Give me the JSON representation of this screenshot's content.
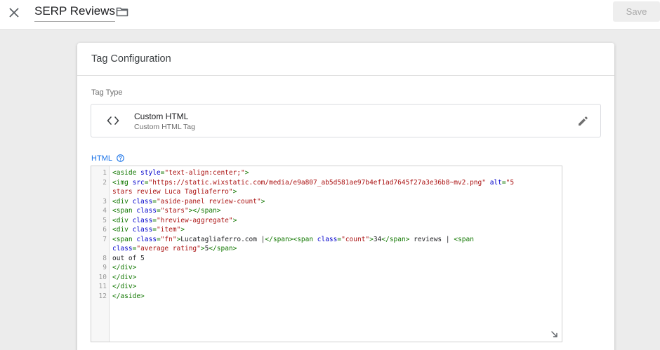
{
  "header": {
    "title": "SERP Reviews",
    "save_label": "Save"
  },
  "card": {
    "title": "Tag Configuration",
    "tag_type_label": "Tag Type",
    "tag_type": {
      "name": "Custom HTML",
      "description": "Custom HTML Tag"
    },
    "html_label": "HTML"
  },
  "icons": {
    "close": "close-icon",
    "folder": "folder-icon",
    "code": "code-icon",
    "edit": "pencil-icon",
    "help": "help-icon",
    "resize": "resize-handle-icon"
  },
  "colors": {
    "accent": "#1a73e8",
    "tag": "#117700",
    "attribute": "#0000cc",
    "string": "#aa1111"
  },
  "editor": {
    "lines": [
      {
        "no": "1",
        "rows": [
          [
            [
              "tag",
              "<aside "
            ],
            [
              "attr",
              "style"
            ],
            [
              "tag",
              "="
            ],
            [
              "str",
              "\"text-align:center;\""
            ],
            [
              "tag",
              ">"
            ]
          ]
        ]
      },
      {
        "no": "2",
        "rows": [
          [
            [
              "tag",
              "<img "
            ],
            [
              "attr",
              "src"
            ],
            [
              "tag",
              "="
            ],
            [
              "str",
              "\"https://static.wixstatic.com/media/e9a807_ab5d581ae97b4ef1ad7645f27a3e36b8~mv2.png\""
            ],
            [
              "text",
              " "
            ],
            [
              "attr",
              "alt"
            ],
            [
              "tag",
              "="
            ],
            [
              "str",
              "\"5"
            ]
          ],
          [
            [
              "str",
              "stars review Luca Tagliaferro\""
            ],
            [
              "tag",
              ">"
            ]
          ]
        ]
      },
      {
        "no": "3",
        "rows": [
          [
            [
              "tag",
              "<div "
            ],
            [
              "attr",
              "class"
            ],
            [
              "tag",
              "="
            ],
            [
              "str",
              "\"aside-panel review-count\""
            ],
            [
              "tag",
              ">"
            ]
          ]
        ]
      },
      {
        "no": "4",
        "rows": [
          [
            [
              "tag",
              "<span "
            ],
            [
              "attr",
              "class"
            ],
            [
              "tag",
              "="
            ],
            [
              "str",
              "\"stars\""
            ],
            [
              "tag",
              "></span>"
            ]
          ]
        ]
      },
      {
        "no": "5",
        "rows": [
          [
            [
              "tag",
              "<div "
            ],
            [
              "attr",
              "class"
            ],
            [
              "tag",
              "="
            ],
            [
              "str",
              "\"hreview-aggregate\""
            ],
            [
              "tag",
              ">"
            ]
          ]
        ]
      },
      {
        "no": "6",
        "rows": [
          [
            [
              "tag",
              "<div "
            ],
            [
              "attr",
              "class"
            ],
            [
              "tag",
              "="
            ],
            [
              "str",
              "\"item\""
            ],
            [
              "tag",
              ">"
            ]
          ]
        ]
      },
      {
        "no": "7",
        "rows": [
          [
            [
              "tag",
              "<span "
            ],
            [
              "attr",
              "class"
            ],
            [
              "tag",
              "="
            ],
            [
              "str",
              "\"fn\""
            ],
            [
              "tag",
              ">"
            ],
            [
              "text",
              "Lucatagliaferro.com |"
            ],
            [
              "tag",
              "</span><span "
            ],
            [
              "attr",
              "class"
            ],
            [
              "tag",
              "="
            ],
            [
              "str",
              "\"count\""
            ],
            [
              "tag",
              ">"
            ],
            [
              "text",
              "34"
            ],
            [
              "tag",
              "</span>"
            ],
            [
              "text",
              " reviews | "
            ],
            [
              "tag",
              "<span"
            ]
          ],
          [
            [
              "attr",
              "class"
            ],
            [
              "tag",
              "="
            ],
            [
              "str",
              "\"average rating\""
            ],
            [
              "tag",
              ">"
            ],
            [
              "text",
              "5"
            ],
            [
              "tag",
              "</span>"
            ]
          ]
        ]
      },
      {
        "no": "8",
        "rows": [
          [
            [
              "text",
              "out of 5"
            ]
          ]
        ]
      },
      {
        "no": "9",
        "rows": [
          [
            [
              "tag",
              "</div>"
            ]
          ]
        ]
      },
      {
        "no": "10",
        "rows": [
          [
            [
              "tag",
              "</div>"
            ]
          ]
        ]
      },
      {
        "no": "11",
        "rows": [
          [
            [
              "tag",
              "</div>"
            ]
          ]
        ]
      },
      {
        "no": "12",
        "rows": [
          [
            [
              "tag",
              "</aside>"
            ]
          ]
        ]
      }
    ]
  }
}
